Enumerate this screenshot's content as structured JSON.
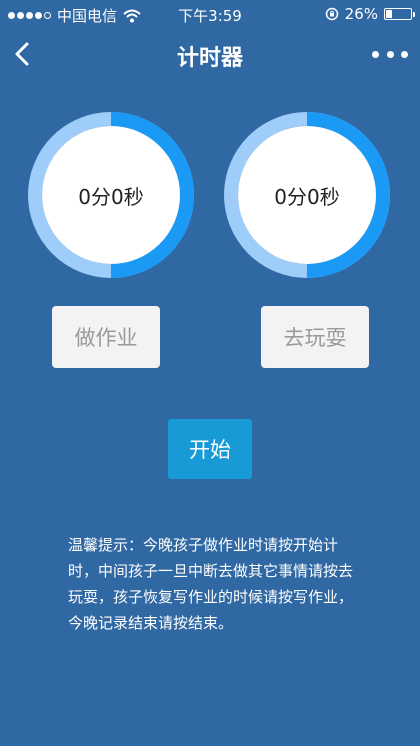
{
  "status_bar": {
    "carrier": "中国电信",
    "time": "下午3:59",
    "battery_percent": "26%",
    "battery_level": 0.26,
    "signal_bars": 4,
    "icons": [
      "signal-dots-icon",
      "wifi-icon",
      "orientation-lock-icon",
      "battery-icon"
    ]
  },
  "nav": {
    "title": "计时器",
    "back_icon": "chevron-left-icon",
    "more_icon": "more-dots-icon"
  },
  "timers": {
    "homework": {
      "value": "0分0秒",
      "progress": 0.5
    },
    "play": {
      "value": "0分0秒",
      "progress": 0.5
    }
  },
  "buttons": {
    "homework_label": "做作业",
    "play_label": "去玩耍",
    "start_label": "开始"
  },
  "tips": "温馨提示：今晚孩子做作业时请按开始计时，中间孩子一旦中断去做其它事情请按去玩耍，孩子恢复写作业的时候请按写作业，今晚记录结束请按结束。",
  "colors": {
    "background": "#2f68a3",
    "ring_light": "#9fcdfa",
    "ring_accent": "#1a99f5",
    "start_button": "#179ad6",
    "mode_button": "#f3f3f3"
  }
}
